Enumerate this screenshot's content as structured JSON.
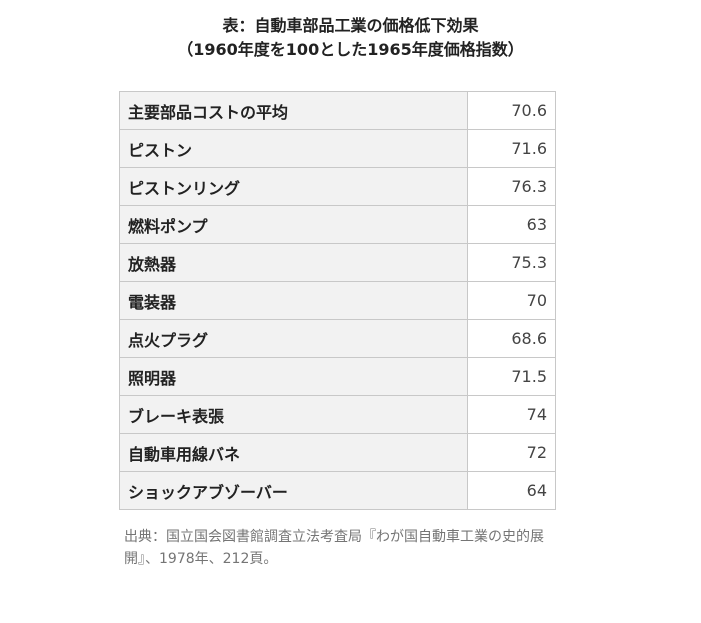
{
  "title": {
    "line1": "表：自動車部品工業の価格低下効果",
    "line2": "（1960年度を100とした1965年度価格指数）"
  },
  "rows": [
    {
      "label": "主要部品コストの平均",
      "value": "70.6"
    },
    {
      "label": "ピストン",
      "value": "71.6"
    },
    {
      "label": "ピストンリング",
      "value": "76.3"
    },
    {
      "label": "燃料ポンプ",
      "value": "63"
    },
    {
      "label": "放熱器",
      "value": "75.3"
    },
    {
      "label": "電装器",
      "value": "70"
    },
    {
      "label": "点火プラグ",
      "value": "68.6"
    },
    {
      "label": "照明器",
      "value": "71.5"
    },
    {
      "label": "ブレーキ表張",
      "value": "74"
    },
    {
      "label": "自動車用線バネ",
      "value": "72"
    },
    {
      "label": "ショックアブゾーバー",
      "value": "64"
    }
  ],
  "source": "出典：国立国会図書館調査立法考査局『わが国自動車工業の史的展開』、1978年、212頁。",
  "colors": {
    "label_background": "#f2f2f2",
    "border": "#c8c8c8",
    "source_text": "#757575"
  }
}
